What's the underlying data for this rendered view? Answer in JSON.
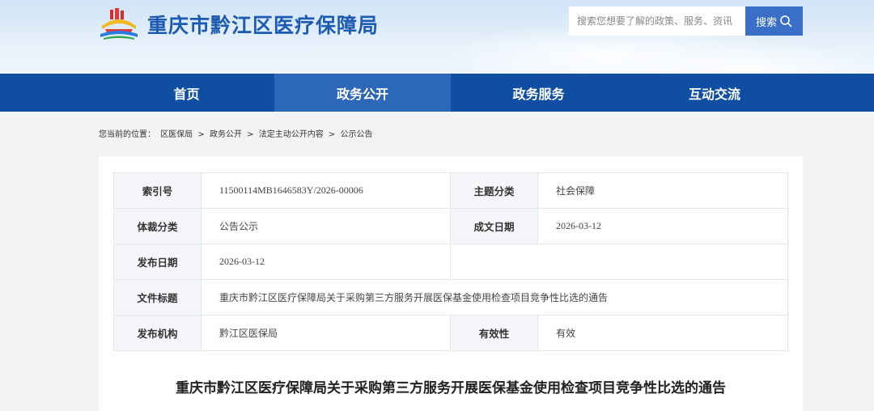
{
  "header": {
    "site_title": "重庆市黔江区医疗保障局",
    "search_placeholder": "搜索您想要了解的政策、服务、资讯",
    "search_button": "搜索"
  },
  "nav": {
    "items": [
      {
        "label": "首页"
      },
      {
        "label": "政务公开"
      },
      {
        "label": "政务服务"
      },
      {
        "label": "互动交流"
      }
    ],
    "active_index": 1
  },
  "breadcrumb": {
    "prefix": "您当前的位置：",
    "items": [
      "区医保局",
      "政务公开",
      "法定主动公开内容",
      "公示公告"
    ],
    "separator": ">"
  },
  "meta": {
    "index_label": "索引号",
    "index_value": "11500114MB1646583Y/2026-00006",
    "topic_label": "主题分类",
    "topic_value": "社会保障",
    "genre_label": "体裁分类",
    "genre_value": "公告公示",
    "created_label": "成文日期",
    "created_value": "2026-03-12",
    "published_label": "发布日期",
    "published_value": "2026-03-12",
    "doc_title_label": "文件标题",
    "doc_title_value": "重庆市黔江区医疗保障局关于采购第三方服务开展医保基金使用检查项目竞争性比选的通告",
    "issuer_label": "发布机构",
    "issuer_value": "黔江区医保局",
    "validity_label": "有效性",
    "validity_value": "有效"
  },
  "article": {
    "title": "重庆市黔江区医疗保障局关于采购第三方服务开展医保基金使用检查项目竞争性比选的通告"
  },
  "colors": {
    "nav_bg": "#0f4ea3",
    "nav_active": "#2c67b8",
    "title_blue": "#1d5bb0",
    "search_button": "#3a6fc7"
  }
}
